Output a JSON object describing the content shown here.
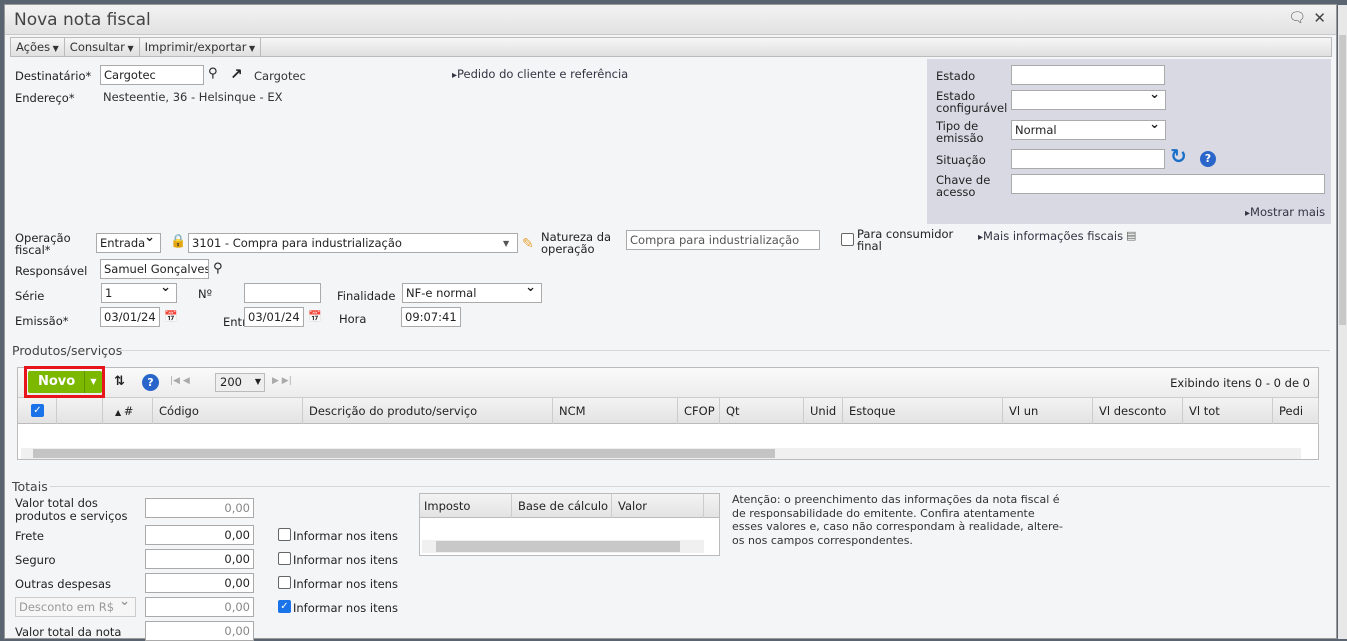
{
  "window": {
    "title": "Nova nota fiscal"
  },
  "menu": [
    "Ações",
    "Consultar",
    "Imprimir/exportar"
  ],
  "header": {
    "destinatario_label": "Destinatário*",
    "destinatario_value": "Cargotec",
    "destinatario_link": "Cargotec",
    "endereco_label": "Endereço*",
    "endereco_value": "Nesteentie, 36 - Helsinque - EX",
    "pedido_link": "Pedido do cliente e referência"
  },
  "panel": {
    "estado_label": "Estado",
    "estado_value": "",
    "estado_conf_label": "Estado configurável",
    "estado_conf_value": "",
    "tipo_label": "Tipo de emissão",
    "tipo_value": "Normal",
    "situacao_label": "Situação",
    "situacao_value": "",
    "chave_label": "Chave de acesso",
    "chave_value": "",
    "mostrar_mais": "Mostrar mais"
  },
  "form": {
    "operacao_label": "Operação fiscal*",
    "operacao_value": "Entrada",
    "cfop_value": "3101 - Compra para industrialização",
    "natureza_label": "Natureza da operação",
    "natureza_value": "Compra para industrialização",
    "consumidor_label": "Para consumidor final",
    "mais_info": "Mais informações fiscais",
    "responsavel_label": "Responsável",
    "responsavel_value": "Samuel Gonçalves",
    "serie_label": "Série",
    "serie_value": "1",
    "numero_label": "Nº",
    "numero_value": "",
    "finalidade_label": "Finalidade",
    "finalidade_value": "NF-e normal",
    "emissao_label": "Emissão*",
    "emissao_value": "03/01/24",
    "entrada_label": "Entrada",
    "entrada_value": "03/01/24",
    "hora_label": "Hora",
    "hora_value": "09:07:41"
  },
  "produtos": {
    "title": "Produtos/serviços",
    "novo": "Novo",
    "page_size": "200",
    "status": "Exibindo itens 0 - 0 de 0",
    "columns": [
      "#",
      "Código",
      "Descrição do produto/serviço",
      "NCM",
      "CFOP",
      "Qt",
      "Unid",
      "Estoque",
      "Vl un",
      "Vl desconto",
      "Vl tot",
      "Pedi"
    ]
  },
  "totais": {
    "title": "Totais",
    "rows": [
      {
        "label": "Valor total dos produtos e serviços",
        "value": "0,00"
      },
      {
        "label": "Frete",
        "value": "0,00"
      },
      {
        "label": "Seguro",
        "value": "0,00"
      },
      {
        "label": "Outras despesas",
        "value": "0,00"
      },
      {
        "label": "Desconto em R$",
        "value": "0,00"
      },
      {
        "label": "Valor total da nota",
        "value": "0,00"
      }
    ],
    "informar": "Informar nos itens",
    "imposto_cols": [
      "Imposto",
      "Base de cálculo",
      "Valor"
    ],
    "aviso": "Atenção: o preenchimento das informações da nota fiscal é de responsabilidade do emitente. Confira atentamente esses valores e, caso não correspondam à realidade, altere-os nos campos correspondentes."
  }
}
